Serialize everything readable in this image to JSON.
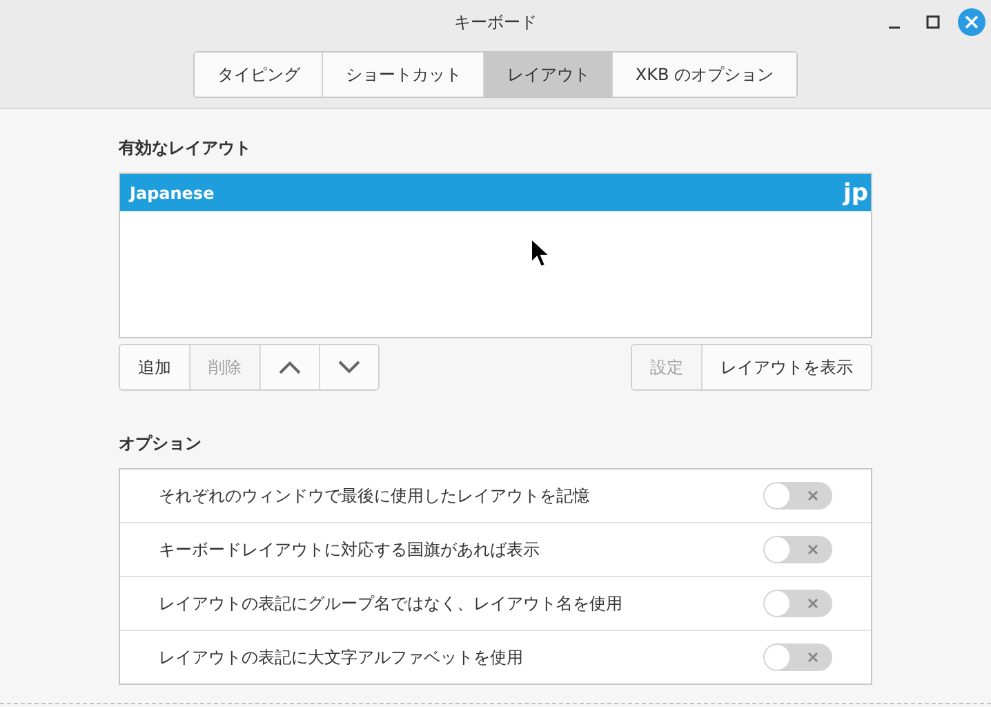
{
  "window": {
    "title": "キーボード"
  },
  "tabs": [
    {
      "label": "タイピング",
      "selected": false
    },
    {
      "label": "ショートカット",
      "selected": false
    },
    {
      "label": "レイアウト",
      "selected": true
    },
    {
      "label": "XKB のオプション",
      "selected": false
    }
  ],
  "layouts_section": {
    "title": "有効なレイアウト",
    "layouts": [
      {
        "name": "Japanese",
        "code": "jp",
        "selected": true
      }
    ],
    "left_buttons": [
      {
        "kind": "text",
        "label": "追加",
        "disabled": false
      },
      {
        "kind": "text",
        "label": "削除",
        "disabled": true
      },
      {
        "kind": "up",
        "disabled": false
      },
      {
        "kind": "down",
        "disabled": false
      }
    ],
    "right_buttons": [
      {
        "kind": "text",
        "label": "設定",
        "disabled": true
      },
      {
        "kind": "text",
        "label": "レイアウトを表示",
        "disabled": false
      }
    ]
  },
  "options_section": {
    "title": "オプション",
    "options": [
      {
        "label": "それぞれのウィンドウで最後に使用したレイアウトを記憶",
        "on": false
      },
      {
        "label": "キーボードレイアウトに対応する国旗があれば表示",
        "on": false
      },
      {
        "label": "レイアウトの表記にグループ名ではなく、レイアウト名を使用",
        "on": false
      },
      {
        "label": "レイアウトの表記に大文字アルファベットを使用",
        "on": false
      }
    ]
  }
}
